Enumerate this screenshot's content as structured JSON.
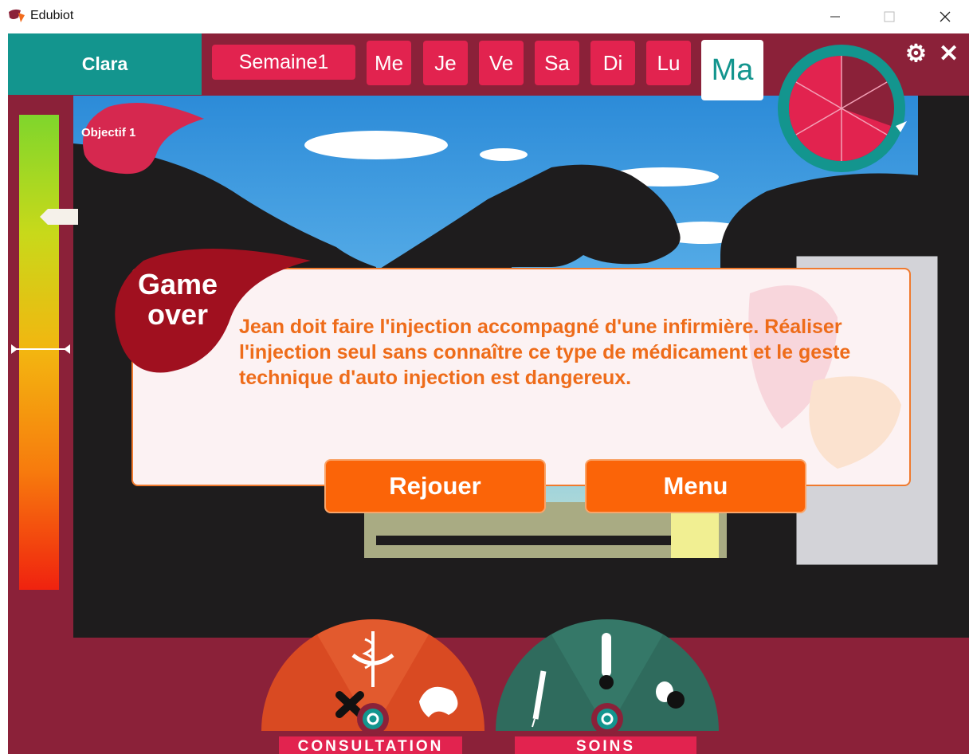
{
  "window": {
    "title": "Edubiot",
    "minimize_symbol": "—",
    "maximize_symbol": "☐",
    "close_symbol": "✕"
  },
  "header": {
    "player_name": "Clara",
    "week_label": "Semaine1",
    "days": [
      "Me",
      "Je",
      "Ve",
      "Sa",
      "Di",
      "Lu"
    ],
    "active_day": "Ma",
    "settings_icon": "gears-icon",
    "close_icon": "close-icon"
  },
  "objective": {
    "label": "Objectif 1"
  },
  "dialog": {
    "title_line1": "Game",
    "title_line2": "over",
    "message": "Jean doit faire l'injection accompagné d'une infirmière. Réaliser l'injection seul sans connaître ce type de médicament et le geste technique d'auto injection est dangereux.",
    "replay_label": "Rejouer",
    "menu_label": "Menu"
  },
  "dock": {
    "consultation_label": "CONSULTATION",
    "soins_label": "SOINS"
  },
  "colors": {
    "teal": "#13958e",
    "crimson": "#e2234f",
    "maroon": "#8b2139",
    "orange": "#fb6408",
    "consultation": "#d94a22",
    "soins": "#2f6b5d"
  }
}
